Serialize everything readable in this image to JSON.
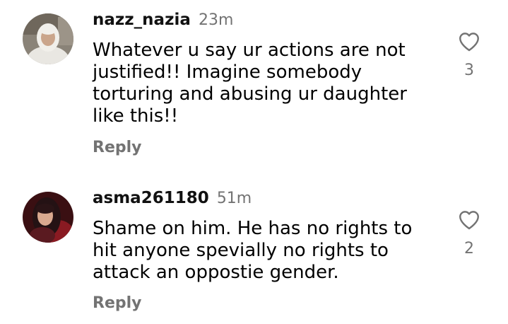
{
  "comments": [
    {
      "username": "nazz_nazia",
      "time": "23m",
      "lines": [
        "Whatever u say ur actions are not",
        "justified!! Imagine somebody",
        "torturing and abusing ur daughter",
        "like this!!"
      ],
      "reply_label": "Reply",
      "like_count": "3",
      "like_icon": "heart-outline-icon"
    },
    {
      "username": "asma261180",
      "time": "51m",
      "lines": [
        "Shame on him. He has no rights to",
        "hit anyone spevially no rights to",
        "attack an oppostie gender."
      ],
      "reply_label": "Reply",
      "like_count": "2",
      "like_icon": "heart-outline-icon"
    }
  ]
}
